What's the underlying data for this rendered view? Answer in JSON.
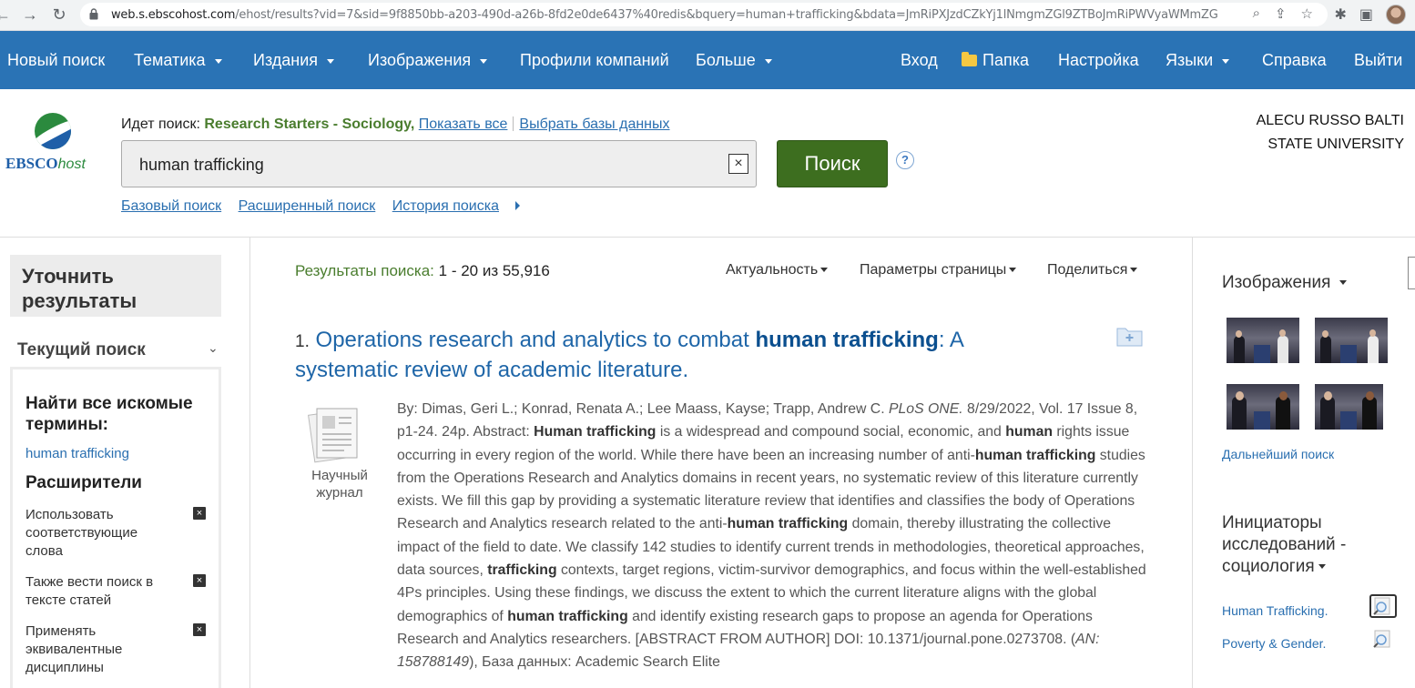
{
  "browser": {
    "url_host": "web.s.ebscohost.com",
    "url_path": "/ehost/results?vid=7&sid=9f8850bb-a203-490d-a26b-8fd2e0de6437%40redis&bquery=human+trafficking&bdata=JmRiPXJzdCZkYj1lNmgmZGl9ZTBoJmRiPWVyaWMmZGl9b..."
  },
  "nav": {
    "new_search": "Новый поиск",
    "subjects": "Тематика",
    "publications": "Издания",
    "images": "Изображения",
    "company_profiles": "Профили компаний",
    "more": "Больше",
    "sign_in": "Вход",
    "folder": "Папка",
    "preferences": "Настройка",
    "languages": "Языки",
    "help": "Справка",
    "exit": "Выйти"
  },
  "header": {
    "logo_main": "EBSCO",
    "logo_host": "host",
    "searching_label": "Идет поиск:",
    "database": "Research Starters - Sociology,",
    "show_all": "Показать все",
    "choose_db": "Выбрать базы данных",
    "query": "human trafficking",
    "clear": "×",
    "search_button": "Поиск",
    "help_mark": "?",
    "basic_search": "Базовый поиск",
    "advanced_search": "Расширенный поиск",
    "search_history": "История поиска",
    "institution": "ALECU RUSSO BALTI STATE UNIVERSITY"
  },
  "sidebar": {
    "refine_title": "Уточнить результаты",
    "current_search": "Текущий поиск",
    "find_all_title": "Найти все искомые термины:",
    "term": "human trafficking",
    "expanders_title": "Расширители",
    "expanders": [
      {
        "label": "Использовать соответствующие слова",
        "remove": "×"
      },
      {
        "label": "Также вести поиск в тексте статей",
        "remove": "×"
      },
      {
        "label": "Применять эквивалентные дисциплины",
        "remove": "×"
      }
    ]
  },
  "results": {
    "summary_label": "Результаты поиска:",
    "summary_range": "1 - 20 из 55,916",
    "sort": "Актуальность",
    "page_options": "Параметры страницы",
    "share": "Поделиться",
    "item": {
      "index": "1.",
      "title_a": "Operations research and analytics to combat",
      "title_b": "human trafficking",
      "title_c": ": A systematic review of academic literature.",
      "type_label": "Научный журнал",
      "abstract": [
        {
          "t": "By: Dimas, Geri L.; Konrad, Renata A.; Lee Maass, Kayse; Trapp, Andrew C. "
        },
        {
          "t": "PLoS ONE.",
          "i": true
        },
        {
          "t": " 8/29/2022, Vol. 17 Issue 8, p1-24. 24p. Abstract: "
        },
        {
          "t": "Human trafficking",
          "b": true
        },
        {
          "t": " is a widespread and compound social, economic, and "
        },
        {
          "t": "human",
          "b": true
        },
        {
          "t": " rights issue occurring in every region of the world. While there have been an increasing number of anti-"
        },
        {
          "t": "human trafficking",
          "b": true
        },
        {
          "t": " studies from the Operations Research and Analytics domains in recent years, no systematic review of this literature currently exists. We fill this gap by providing a systematic literature review that identifies and classifies the body of Operations Research and Analytics research related to the anti-"
        },
        {
          "t": "human trafficking",
          "b": true
        },
        {
          "t": " domain, thereby illustrating the collective impact of the field to date. We classify 142 studies to identify current trends in methodologies, theoretical approaches, data sources, "
        },
        {
          "t": "trafficking",
          "b": true
        },
        {
          "t": " contexts, target regions, victim-survivor demographics, and focus within the well-established 4Ps principles. Using these findings, we discuss the extent to which the current literature aligns with the global demographics of "
        },
        {
          "t": "human trafficking",
          "b": true
        },
        {
          "t": " and identify existing research gaps to propose an agenda for Operations Research and Analytics researchers. [ABSTRACT FROM AUTHOR] DOI: 10.1371/journal.pone.0273708. ("
        },
        {
          "t": "AN: 158788149",
          "i": true
        },
        {
          "t": "), База данных: Academic Search Elite"
        }
      ]
    }
  },
  "right": {
    "images_title": "Изображения",
    "further_search": "Дальнейший поиск",
    "initiators_title": "Инициаторы исследований - социология",
    "initiators": [
      "Human Trafficking.",
      "Poverty & Gender."
    ]
  },
  "colors": {
    "nav_bg": "#2a73b5",
    "search_button": "#3d6e1f",
    "link": "#2a6fb0",
    "db_green": "#4a7d2e"
  }
}
